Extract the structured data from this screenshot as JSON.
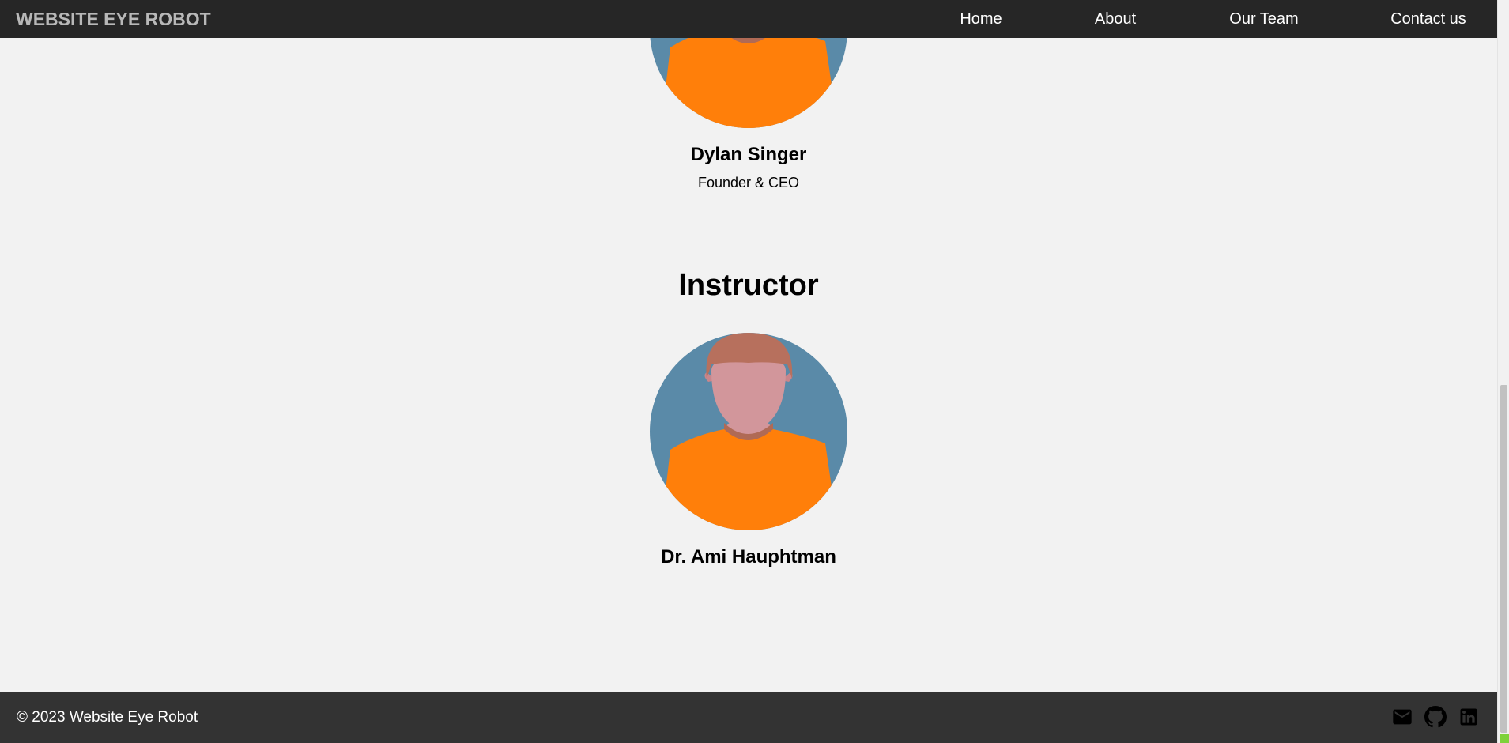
{
  "navbar": {
    "brand": "WEBSITE EYE ROBOT",
    "links": [
      {
        "label": "Home"
      },
      {
        "label": "About"
      },
      {
        "label": "Our Team"
      },
      {
        "label": "Contact us"
      }
    ]
  },
  "team": {
    "founder": {
      "name": "Dylan Singer",
      "role": "Founder & CEO"
    },
    "instructor_heading": "Instructor",
    "instructor": {
      "name": "Dr. Ami Hauphtman"
    }
  },
  "avatar_icon": "person-avatar-icon",
  "footer": {
    "copyright": "© 2023 Website Eye Robot",
    "social_icons": [
      "mail-icon",
      "github-icon",
      "linkedin-icon"
    ]
  },
  "colors": {
    "navbar_bg": "#262626",
    "brand_text": "#b8b8b8",
    "page_bg": "#f2f2f2",
    "footer_bg": "#333333",
    "avatar_bg": "#5a8aa8",
    "avatar_shirt": "#ff7f0a",
    "avatar_skin": "#d2969b",
    "avatar_hair": "#b7705d"
  }
}
